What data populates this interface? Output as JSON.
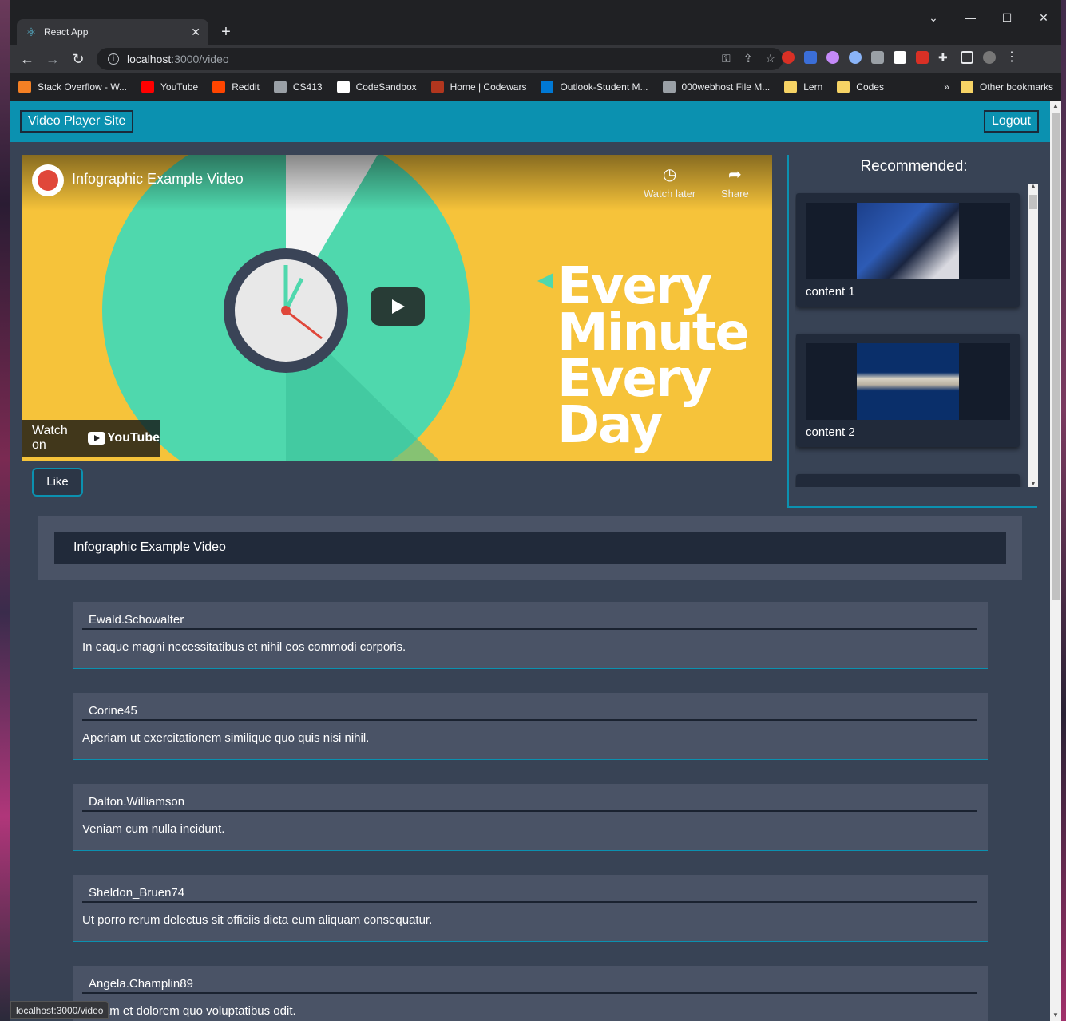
{
  "browser": {
    "tab_title": "React App",
    "url_host": "localhost",
    "url_path": ":3000/video",
    "bookmarks": [
      {
        "label": "Stack Overflow - W...",
        "color": "#f48024"
      },
      {
        "label": "YouTube",
        "color": "#ff0000"
      },
      {
        "label": "Reddit",
        "color": "#ff4500"
      },
      {
        "label": "CS413",
        "color": "#9aa0a6"
      },
      {
        "label": "CodeSandbox",
        "color": "#ffffff"
      },
      {
        "label": "Home | Codewars",
        "color": "#b1361e"
      },
      {
        "label": "Outlook-Student M...",
        "color": "#0078d4"
      },
      {
        "label": "000webhost File M...",
        "color": "#9aa0a6"
      },
      {
        "label": "Lern",
        "color": "#f6d365"
      },
      {
        "label": "Codes",
        "color": "#f6d365"
      }
    ],
    "other_bookmarks": "Other bookmarks",
    "more_glyph": "»",
    "status_url": "localhost:3000/video"
  },
  "app": {
    "brand": "Video Player Site",
    "logout": "Logout",
    "like": "Like",
    "recommended_heading": "Recommended:",
    "video_title": "Infographic Example Video"
  },
  "player": {
    "title": "Infographic Example Video",
    "watch_later": "Watch later",
    "share": "Share",
    "watch_on": "Watch on",
    "yt_brand": "YouTube",
    "big_text": [
      "Every",
      "Minute",
      "Every",
      "Day"
    ]
  },
  "recommended": [
    {
      "label": "content 1"
    },
    {
      "label": "content 2"
    }
  ],
  "comments": [
    {
      "user": "Ewald.Schowalter",
      "text": "In eaque magni necessitatibus et nihil eos commodi corporis."
    },
    {
      "user": "Corine45",
      "text": "Aperiam ut exercitationem similique quo quis nisi nihil."
    },
    {
      "user": "Dalton.Williamson",
      "text": "Veniam cum nulla incidunt."
    },
    {
      "user": "Sheldon_Bruen74",
      "text": "Ut porro rerum delectus sit officiis dicta eum aliquam consequatur."
    },
    {
      "user": "Angela.Champlin89",
      "text": "Veriam et dolorem quo voluptatibus odit."
    }
  ],
  "colors": {
    "accent": "#0b91b0",
    "page_bg": "#384355",
    "card_bg": "#4a5366",
    "dark_card": "#212a3a"
  }
}
